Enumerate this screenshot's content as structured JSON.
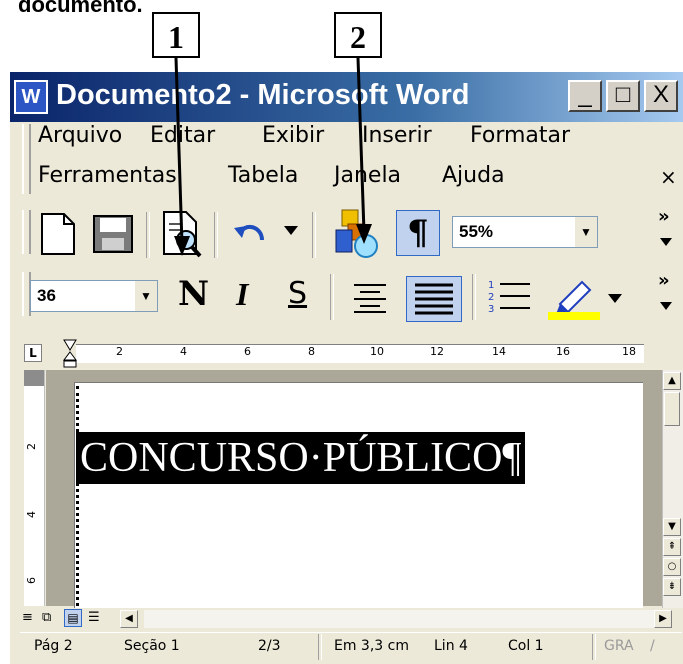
{
  "caption": "documento.",
  "callouts": {
    "c1": "1",
    "c2": "2"
  },
  "window": {
    "title": "Documento2 - Microsoft Word",
    "min": "_",
    "max": "□",
    "close": "X"
  },
  "menu": {
    "row1": [
      "Arquivo",
      "Editar",
      "Exibir",
      "Inserir",
      "Formatar"
    ],
    "row2": [
      "Ferramentas",
      "Tabela",
      "Janela",
      "Ajuda"
    ],
    "close": "×"
  },
  "toolbar_standard": {
    "zoom": "55%",
    "icons": [
      "new-document-icon",
      "save-icon",
      "print-preview-icon",
      "undo-icon",
      "insert-clipart-icon",
      "show-hide-pilcrow-icon"
    ],
    "pilcrow": "¶"
  },
  "toolbar_format": {
    "font_size": "36",
    "bold": "N",
    "italic": "I",
    "strike": "S"
  },
  "ruler": {
    "ticks": [
      "2",
      "4",
      "6",
      "8",
      "10",
      "12",
      "14",
      "16",
      "18"
    ]
  },
  "vruler": {
    "ticks": [
      "2",
      "4",
      "6"
    ]
  },
  "document": {
    "text": "CONCURSO·PÚBLICO¶"
  },
  "status": {
    "page": "Pág 2",
    "section": "Seção 1",
    "pages": "2/3",
    "at": "Em 3,3 cm",
    "line": "Lin 4",
    "col": "Col 1",
    "gra": "GRA"
  },
  "colors": {
    "titlebar": "#0a246a",
    "highlight": "#ffff00",
    "selection": "#000000"
  }
}
